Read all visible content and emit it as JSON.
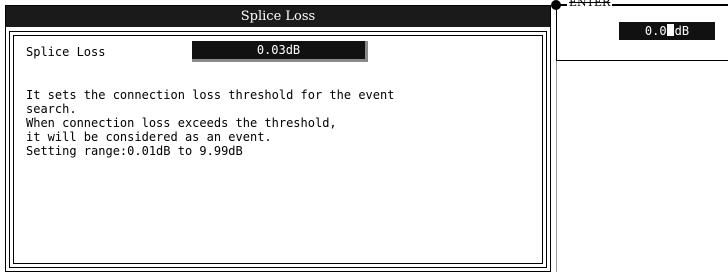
{
  "dialog": {
    "title": "Splice Loss",
    "field_label": "Splice Loss",
    "field_value": "0.03dB",
    "description": [
      "It sets the connection loss threshold for the event",
      "search.",
      "When connection loss exceeds the threshold,",
      "it will be considered as an event.",
      "Setting range:0.01dB to 9.99dB"
    ]
  },
  "enter_panel": {
    "label": "ENTER",
    "value_prefix": "0.0",
    "value_suffix": "dB"
  }
}
